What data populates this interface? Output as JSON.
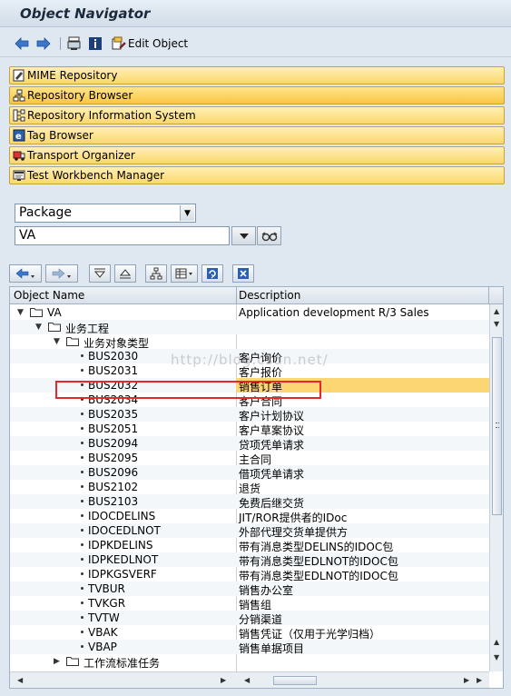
{
  "window": {
    "title": "Object Navigator"
  },
  "toolbar": {
    "edit_object_label": "Edit Object"
  },
  "navigation": [
    {
      "label": "MIME Repository",
      "icon": "mime-repository-icon"
    },
    {
      "label": "Repository Browser",
      "icon": "repository-browser-icon"
    },
    {
      "label": "Repository Information System",
      "icon": "repository-info-system-icon"
    },
    {
      "label": "Tag Browser",
      "icon": "tag-browser-icon"
    },
    {
      "label": "Transport Organizer",
      "icon": "transport-organizer-icon"
    },
    {
      "label": "Test Workbench Manager",
      "icon": "test-workbench-icon"
    }
  ],
  "object_selector": {
    "type_value": "Package",
    "name_value": "VA"
  },
  "tree": {
    "columns": {
      "name": "Object Name",
      "description": "Description"
    },
    "rows": [
      {
        "name": "VA",
        "description": "Application development R/3 Sales",
        "kind": "folder-open",
        "level": 0
      },
      {
        "name": "业务工程",
        "description": "",
        "kind": "folder-open",
        "level": 1
      },
      {
        "name": "业务对象类型",
        "description": "",
        "kind": "folder-open",
        "level": 2
      },
      {
        "name": "BUS2030",
        "description": "客户询价",
        "kind": "leaf",
        "level": 3
      },
      {
        "name": "BUS2031",
        "description": "客户报价",
        "kind": "leaf",
        "level": 3
      },
      {
        "name": "BUS2032",
        "description": "销售订单",
        "kind": "leaf",
        "level": 3,
        "selected": true
      },
      {
        "name": "BUS2034",
        "description": "客户合同",
        "kind": "leaf",
        "level": 3
      },
      {
        "name": "BUS2035",
        "description": "客户计划协议",
        "kind": "leaf",
        "level": 3
      },
      {
        "name": "BUS2051",
        "description": "客户草案协议",
        "kind": "leaf",
        "level": 3
      },
      {
        "name": "BUS2094",
        "description": "贷项凭单请求",
        "kind": "leaf",
        "level": 3
      },
      {
        "name": "BUS2095",
        "description": "主合同",
        "kind": "leaf",
        "level": 3
      },
      {
        "name": "BUS2096",
        "description": "借项凭单请求",
        "kind": "leaf",
        "level": 3
      },
      {
        "name": "BUS2102",
        "description": "退货",
        "kind": "leaf",
        "level": 3
      },
      {
        "name": "BUS2103",
        "description": "免费后继交货",
        "kind": "leaf",
        "level": 3
      },
      {
        "name": "IDOCDELINS",
        "description": "JIT/ROR提供者的IDoc",
        "kind": "leaf",
        "level": 3
      },
      {
        "name": "IDOCEDLNOT",
        "description": "外部代理交货单提供方",
        "kind": "leaf",
        "level": 3
      },
      {
        "name": "IDPKDELINS",
        "description": "带有消息类型DELINS的IDOC包",
        "kind": "leaf",
        "level": 3
      },
      {
        "name": "IDPKEDLNOT",
        "description": "带有消息类型EDLNOT的IDOC包",
        "kind": "leaf",
        "level": 3
      },
      {
        "name": "IDPKGSVERF",
        "description": "带有消息类型EDLNOT的IDOC包",
        "kind": "leaf",
        "level": 3
      },
      {
        "name": "TVBUR",
        "description": "销售办公室",
        "kind": "leaf",
        "level": 3
      },
      {
        "name": "TVKGR",
        "description": "销售组",
        "kind": "leaf",
        "level": 3
      },
      {
        "name": "TVTW",
        "description": "分销渠道",
        "kind": "leaf",
        "level": 3
      },
      {
        "name": "VBAK",
        "description": "销售凭证（仅用于光学归档）",
        "kind": "leaf",
        "level": 3
      },
      {
        "name": "VBAP",
        "description": "销售单据项目",
        "kind": "leaf",
        "level": 3
      },
      {
        "name": "工作流标准任务",
        "description": "",
        "kind": "folder-closed",
        "level": 2
      }
    ]
  },
  "watermark": "http://blog.csdn.net/",
  "colors": {
    "nav_bar": "#fbd76d",
    "selected_row": "#fcd672",
    "highlight_box": "#e8262b"
  }
}
